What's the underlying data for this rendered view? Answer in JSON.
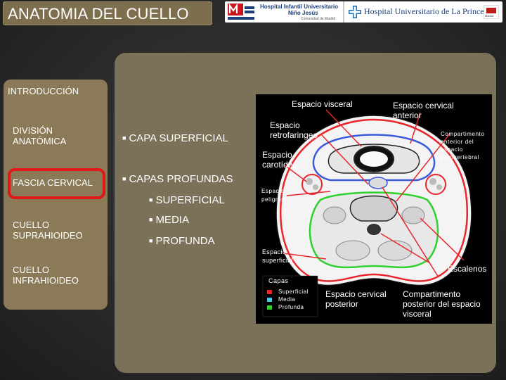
{
  "header": {
    "title": "ANATOMIA DEL CUELLO",
    "logo1": {
      "line1": "Hospital Infantil Universitario",
      "line2": "Niño Jesús",
      "sub": "Comunidad de Madrid",
      "brand": "SaludMadrid"
    },
    "logo2": {
      "name": "Hospital Universitario de La Princesa",
      "badge": "Madrid"
    }
  },
  "nav": {
    "items": [
      {
        "label": "INTRODUCCIÓN"
      },
      {
        "label": "DIVISIÓN ANATÓMICA"
      },
      {
        "label": "FASCIA CERVICAL",
        "selected": true
      },
      {
        "label": "CUELLO SUPRAHIOIDEO"
      },
      {
        "label": "CUELLO INFRAHIOIDEO"
      }
    ],
    "highlight_color": "#e01717"
  },
  "content": {
    "bullets": [
      {
        "label": "CAPA SUPERFICIAL",
        "level": 1
      },
      {
        "label": "CAPAS PROFUNDAS",
        "level": 1
      },
      {
        "label": "SUPERFICIAL",
        "level": 2
      },
      {
        "label": "MEDIA",
        "level": 2
      },
      {
        "label": "PROFUNDA",
        "level": 2
      }
    ]
  },
  "figure": {
    "labels": {
      "espacio_visceral": "Espacio visceral",
      "espacio_cervical_anterior": "Espacio cervical anterior",
      "espacio_retrofaringeo": "Espacio retrofaringeo",
      "compartimento_anterior": "Compartimento anterior del espacio perovertebral",
      "espacio_carotideo": "Espacio carotídeo",
      "espacio_peligroso": "Espacio peligroso",
      "espacio_superficial": "Espacio superficial",
      "escalenos": "Escalenos",
      "espacio_cervical_posterior": "Espacio cervical posterior",
      "compartimento_posterior": "Compartimento posterior del espacio visceral"
    },
    "legend": {
      "title": "Capas",
      "items": [
        {
          "label": "Superficial",
          "color": "#e8262b"
        },
        {
          "label": "Media",
          "color": "#4fc3e0"
        },
        {
          "label": "Profunda",
          "color": "#2fd12f"
        }
      ]
    },
    "layer_colors": {
      "superficial": "#e8262b",
      "media": "#3b5bdc",
      "profunda": "#2fd12f",
      "arrows": "#e8262b"
    }
  },
  "theme": {
    "panel": "#7b7058",
    "nav_panel": "#8a7a57",
    "title_panel": "#7d6f4e",
    "background": "#2a2a2a"
  }
}
